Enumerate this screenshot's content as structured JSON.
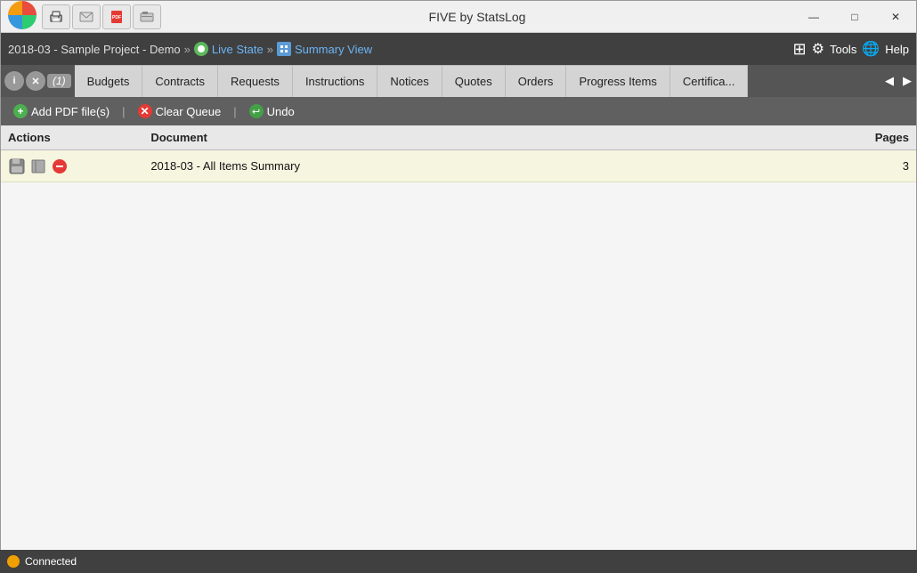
{
  "app": {
    "title": "FIVE by StatsLog"
  },
  "title_bar": {
    "toolbar_buttons": [
      "print-icon",
      "email-icon",
      "pdf-icon",
      "fax-icon"
    ]
  },
  "breadcrumb": {
    "project": "2018-03 - Sample Project - Demo",
    "sep1": "»",
    "live_state": "Live State",
    "sep2": "»",
    "summary_view": "Summary View"
  },
  "right_tools": {
    "tools_label": "Tools",
    "help_label": "Help"
  },
  "tabs": [
    {
      "id": "budgets",
      "label": "Budgets",
      "active": false
    },
    {
      "id": "contracts",
      "label": "Contracts",
      "active": false
    },
    {
      "id": "requests",
      "label": "Requests",
      "active": false
    },
    {
      "id": "instructions",
      "label": "Instructions",
      "active": false
    },
    {
      "id": "notices",
      "label": "Notices",
      "active": false
    },
    {
      "id": "quotes",
      "label": "Quotes",
      "active": false
    },
    {
      "id": "orders",
      "label": "Orders",
      "active": false
    },
    {
      "id": "progress-items",
      "label": "Progress Items",
      "active": false
    },
    {
      "id": "certificates",
      "label": "Certifica...",
      "active": false
    }
  ],
  "tab_counter": "(1)",
  "toolbar": {
    "add_pdf_label": "Add PDF file(s)",
    "clear_queue_label": "Clear Queue",
    "undo_label": "Undo"
  },
  "columns": {
    "actions": "Actions",
    "document": "Document",
    "pages": "Pages"
  },
  "rows": [
    {
      "doc_name": "2018-03 - All Items Summary",
      "pages": "3"
    }
  ],
  "status": {
    "connected": "Connected"
  },
  "window_controls": {
    "minimize": "—",
    "restore": "□",
    "close": "✕"
  }
}
